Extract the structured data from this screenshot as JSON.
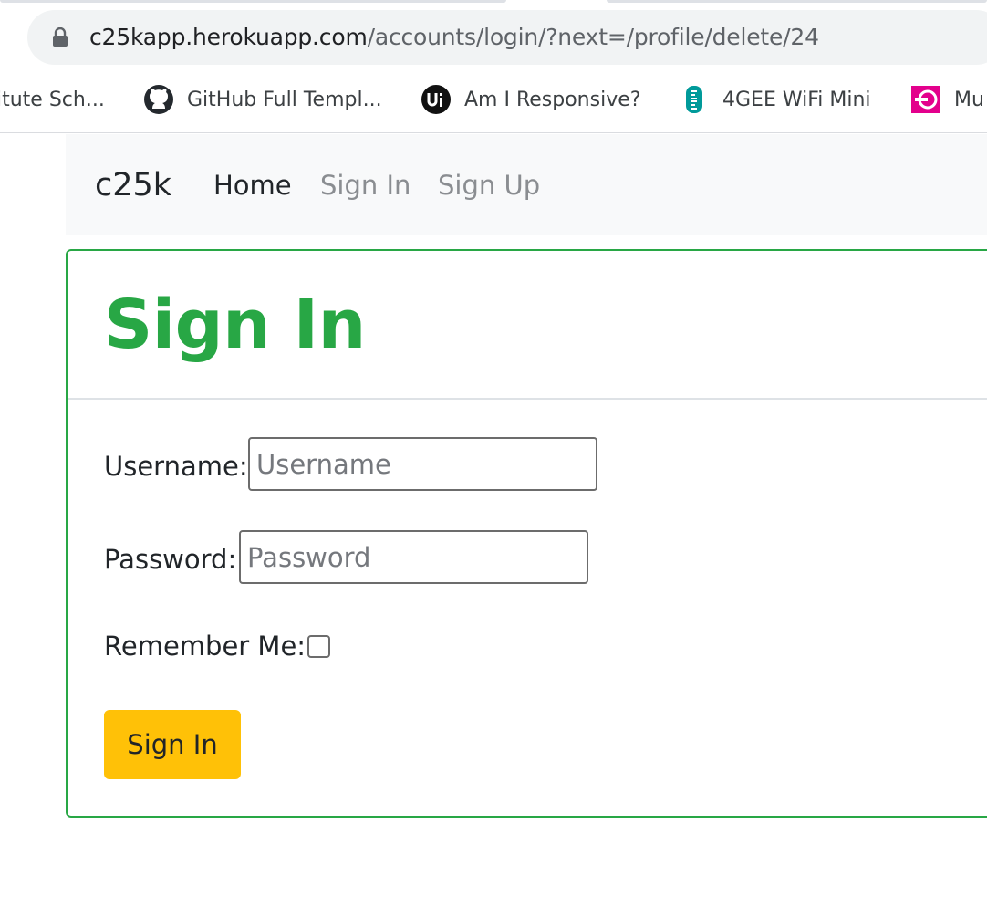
{
  "browser": {
    "url_host": "c25kapp.herokuapp.com",
    "url_path": "/accounts/login/?next=/profile/delete/24",
    "bookmarks": [
      {
        "label": "itute Sch...",
        "icon": "none"
      },
      {
        "label": "GitHub Full Templ...",
        "icon": "github-icon"
      },
      {
        "label": "Am I Responsive?",
        "icon": "ui-icon"
      },
      {
        "label": "4GEE WiFi Mini",
        "icon": "ee-icon"
      },
      {
        "label": "Mu",
        "icon": "pink-logo-icon"
      }
    ]
  },
  "navbar": {
    "brand": "c25k",
    "links": [
      "Home",
      "Sign In",
      "Sign Up"
    ]
  },
  "form": {
    "title": "Sign In",
    "username_label": "Username:",
    "username_placeholder": "Username",
    "password_label": "Password:",
    "password_placeholder": "Password",
    "remember_label": "Remember Me:",
    "remember_checked": false,
    "submit_label": "Sign In"
  },
  "colors": {
    "success": "#28a745",
    "warning": "#ffc107",
    "navbar_bg": "#f8f9fa"
  }
}
